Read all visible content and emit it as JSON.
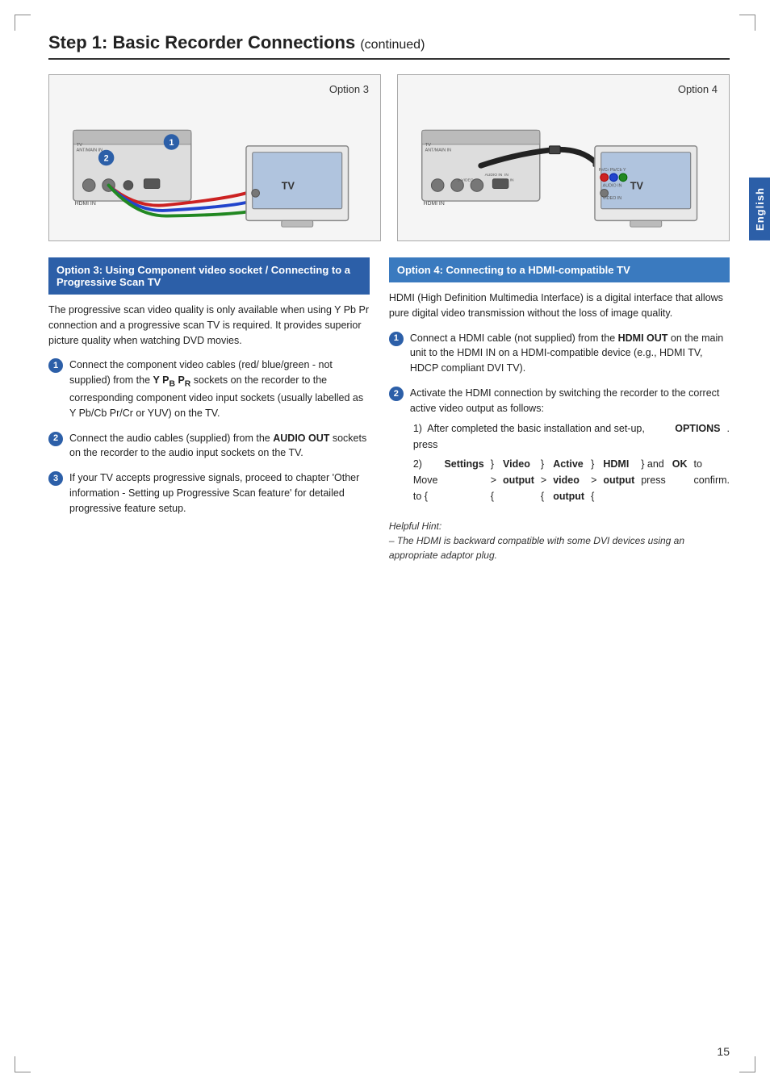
{
  "page": {
    "title": "Step 1: Basic Recorder Connections",
    "continued": "(continued)",
    "page_number": "15",
    "english_tab": "English"
  },
  "diagrams": [
    {
      "id": "diagram-option3",
      "label": "Option 3"
    },
    {
      "id": "diagram-option4",
      "label": "Option 4"
    }
  ],
  "left_column": {
    "option_header": "Option 3: Using Component video socket / Connecting to a Progressive Scan TV",
    "intro_text": "The progressive scan video quality is only available when using Y Pb Pr connection and a progressive scan TV is required. It provides superior picture quality when watching DVD movies.",
    "steps": [
      {
        "number": "1",
        "text": "Connect the component video cables (red/ blue/green - not supplied) from the Y PB PR sockets on the recorder to the corresponding component video input sockets (usually labelled as Y Pb/Cb Pr/Cr or YUV) on the TV."
      },
      {
        "number": "2",
        "text": "Connect the audio cables (supplied) from the AUDIO OUT sockets on the recorder to the audio input sockets on the TV."
      },
      {
        "number": "3",
        "text": "If your TV accepts progressive signals, proceed to chapter 'Other information - Setting up Progressive Scan feature' for detailed progressive feature setup."
      }
    ]
  },
  "right_column": {
    "option_header": "Option 4: Connecting to a HDMI-compatible TV",
    "intro_text": "HDMI (High Definition Multimedia Interface) is a digital interface that allows pure digital video transmission without the loss of image quality.",
    "steps": [
      {
        "number": "1",
        "text_parts": [
          "Connect a HDMI cable (not supplied) from the ",
          "HDMI OUT",
          " on the main unit to the HDMI IN on a HDMI-compatible device (e.g., HDMI TV, HDCP compliant DVI TV)."
        ]
      },
      {
        "number": "2",
        "intro": "Activate the HDMI connection by switching the recorder to the correct active video output as follows:",
        "sub_steps": [
          "1)  After completed the basic installation and set-up, press OPTIONS.",
          "2)  Move to { Settings } > { Video output } > { Active video output } > { HDMI output } and press OK to confirm."
        ]
      }
    ],
    "helpful_hint_title": "Helpful Hint:",
    "helpful_hint_text": "– The HDMI is backward compatible with some DVI devices using an appropriate adaptor plug."
  }
}
